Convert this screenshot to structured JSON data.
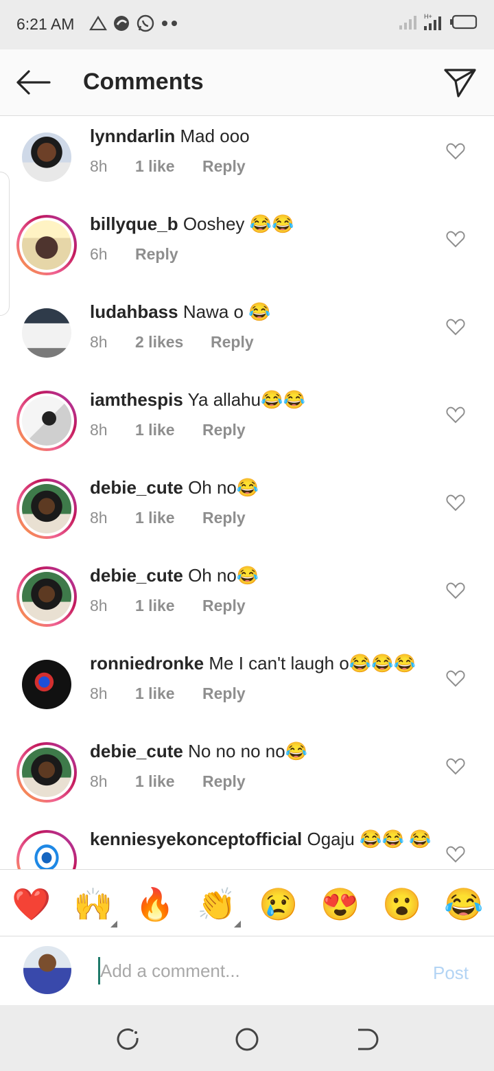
{
  "status_bar": {
    "time": "6:21 AM"
  },
  "header": {
    "title": "Comments"
  },
  "comments": [
    {
      "username": "lynndarlin",
      "text": "Mad ooo",
      "time": "8h",
      "likes": "1 like",
      "reply": "Reply"
    },
    {
      "username": "billyque_b",
      "text": "Ooshey 😂😂",
      "time": "6h",
      "likes": "",
      "reply": "Reply"
    },
    {
      "username": "ludahbass",
      "text": "Nawa o 😂",
      "time": "8h",
      "likes": "2 likes",
      "reply": "Reply"
    },
    {
      "username": "iamthespis",
      "text": "Ya allahu😂😂",
      "time": "8h",
      "likes": "1 like",
      "reply": "Reply"
    },
    {
      "username": "debie_cute",
      "text": "Oh no😂",
      "time": "8h",
      "likes": "1 like",
      "reply": "Reply"
    },
    {
      "username": "debie_cute",
      "text": "Oh no😂",
      "time": "8h",
      "likes": "1 like",
      "reply": "Reply"
    },
    {
      "username": "ronniedronke",
      "text": "Me I can't laugh o😂😂😂",
      "time": "8h",
      "likes": "1 like",
      "reply": "Reply"
    },
    {
      "username": "debie_cute",
      "text": "No no no no😂",
      "time": "8h",
      "likes": "1 like",
      "reply": "Reply"
    },
    {
      "username": "kenniesyekonceptofficial",
      "text": "Ogaju 😂😂 😂",
      "time": "",
      "likes": "",
      "reply": ""
    }
  ],
  "emoji_bar": [
    "❤️",
    "🙌",
    "🔥",
    "👏",
    "😢",
    "😍",
    "😮",
    "😂"
  ],
  "composer": {
    "placeholder": "Add a comment...",
    "post_label": "Post"
  },
  "colors": {
    "post_disabled": "#b3d4f4",
    "meta_gray": "#8e8e8e",
    "story_ring": "#e1306c"
  }
}
